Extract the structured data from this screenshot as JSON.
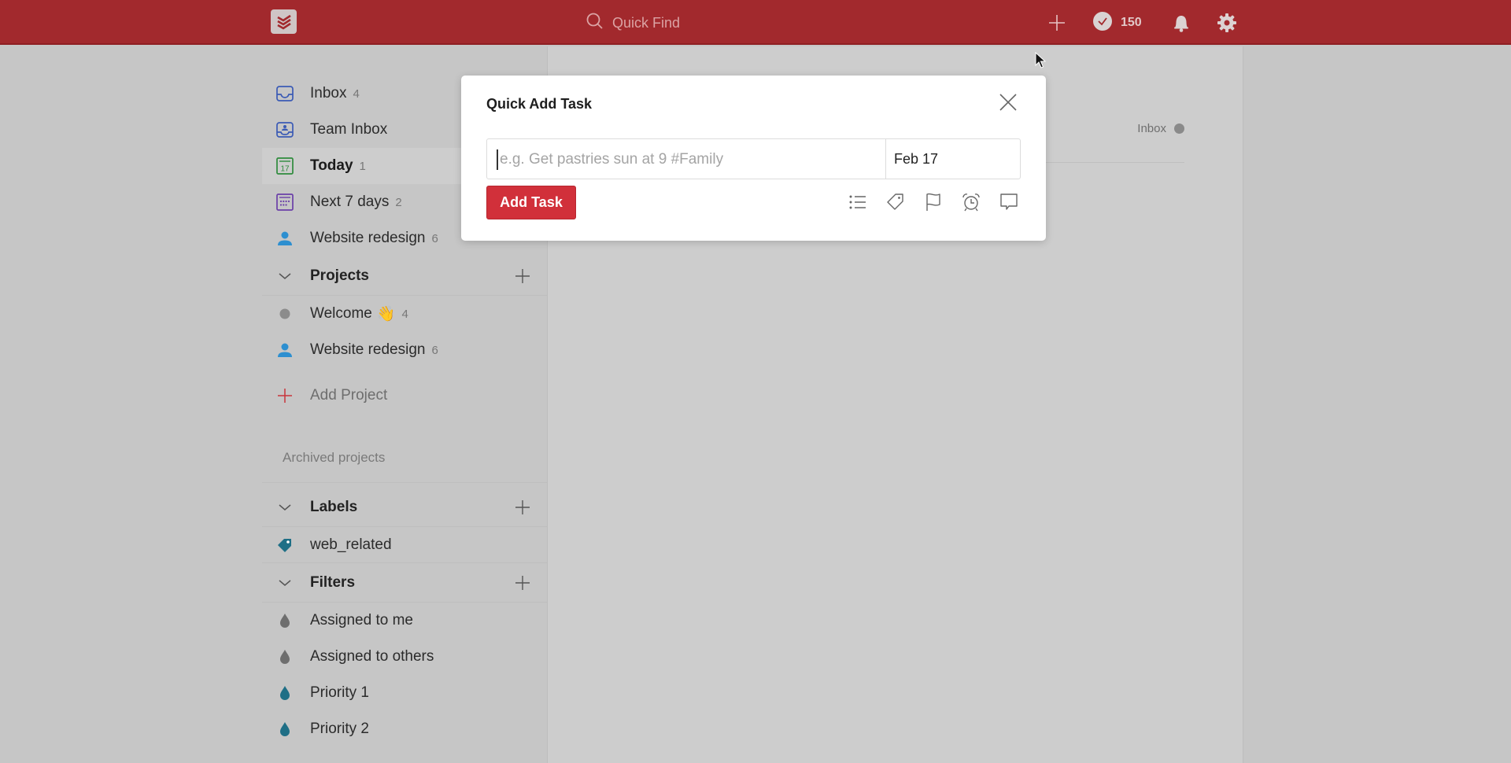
{
  "topbar": {
    "logo_icon": "todoist-logo-icon",
    "search_placeholder": "Quick Find",
    "karma_count": "150",
    "icons": [
      "plus-icon",
      "karma-check-icon",
      "bell-icon",
      "gear-icon"
    ],
    "brand_color": "#a2292d"
  },
  "sidebar": {
    "nav": [
      {
        "label": "Inbox",
        "count": "4",
        "icon": "inbox-icon"
      },
      {
        "label": "Team Inbox",
        "count": "",
        "icon": "team-inbox-icon"
      },
      {
        "label": "Today",
        "count": "1",
        "icon": "calendar-today-icon",
        "day": "17",
        "active": true
      },
      {
        "label": "Next 7 days",
        "count": "2",
        "icon": "calendar-week-icon"
      },
      {
        "label": "Website redesign",
        "count": "6",
        "icon": "person-icon"
      }
    ],
    "projects": {
      "title": "Projects",
      "items": [
        {
          "label": "Welcome",
          "emoji": "👋",
          "count": "4",
          "icon": "gray-dot-icon"
        },
        {
          "label": "Website redesign",
          "count": "6",
          "icon": "person-icon"
        }
      ],
      "add_label": "Add Project",
      "archived_label": "Archived projects"
    },
    "labels": {
      "title": "Labels",
      "items": [
        {
          "label": "web_related",
          "icon": "tag-icon"
        }
      ]
    },
    "filters": {
      "title": "Filters",
      "items": [
        {
          "label": "Assigned to me",
          "color": "#6e6e6e"
        },
        {
          "label": "Assigned to others",
          "color": "#6e6e6e"
        },
        {
          "label": "Priority 1",
          "color": "#1f6f86"
        },
        {
          "label": "Priority 2",
          "color": "#1f6f86"
        }
      ]
    }
  },
  "main": {
    "project_tag": "Inbox"
  },
  "modal": {
    "title": "Quick Add Task",
    "input_placeholder": "e.g. Get pastries sun at 9 #Family",
    "input_value": "",
    "date_value": "Feb 17",
    "submit_label": "Add Task",
    "tools": [
      "project-list-icon",
      "label-tag-icon",
      "priority-flag-icon",
      "reminder-alarm-icon",
      "comment-icon"
    ],
    "accent_color": "#d1303a"
  }
}
